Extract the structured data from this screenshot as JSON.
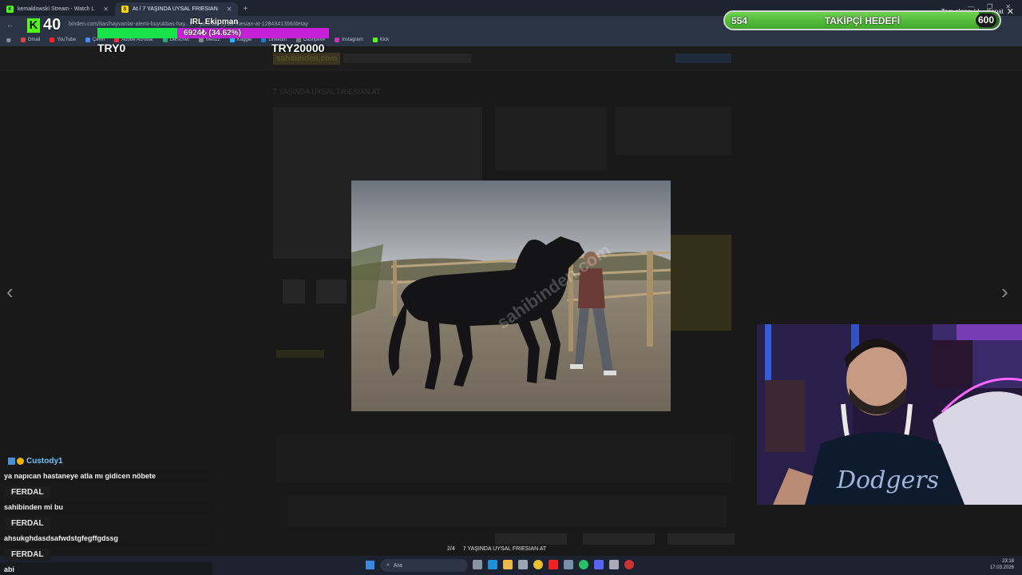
{
  "browser": {
    "tabs": [
      {
        "label": "kemaldowski Stream - Watch L",
        "favicon": "kick-icon",
        "color": "#53fc18",
        "active": false
      },
      {
        "label": "At / 7 YAŞINDA UYSAL FRIESIAN",
        "favicon": "sahibinden-icon",
        "color": "#ffd400",
        "active": true
      }
    ],
    "url": "binden.com/ilan/hayvanlar-alemi-buyukbas-hay...k-7-yasinda-uysal-friesian-at-1284341356/detay",
    "bookmarks": [
      "Gmail",
      "YouTube",
      "Çeviri",
      "Adobe Acrobat",
      "Dersonet",
      "Meuzz",
      "Kaggle",
      "LinkedIn",
      "Dashpeve",
      "Instagram",
      "Kick"
    ]
  },
  "page": {
    "logo": "sahibinden.com",
    "title": "7 YAŞINDA UYSAL FRIESIAN AT",
    "fullscreen_label": "Tam ekran",
    "close_label": "Kapat",
    "photo_caption": "7 YAŞINDA UYSAL FRIESIAN AT",
    "photo_counter": "2/4",
    "watermark": "sahibinden.com"
  },
  "overlay": {
    "kick_followers": "40",
    "try_left": "TRY0",
    "try_right": "TRY20000",
    "irl_title": "IRL Ekipman",
    "progress_text": "6924₺ (34.62%)",
    "progress_fraction": 0.3462,
    "follow_goal": {
      "title": "TAKİPÇİ HEDEFİ",
      "current": "554",
      "target": "600",
      "fraction": 0.923
    }
  },
  "chat": [
    {
      "user": "Custody1",
      "message": "ya napıcan hastaneye atla mı gidicen nöbete"
    },
    {
      "user": "FERDAL",
      "message": "sahibinden mi bu"
    },
    {
      "user": "FERDAL",
      "message": "ahsukghdasdsafwdstgfegffgdssg"
    },
    {
      "user": "FERDAL",
      "message": "abi"
    }
  ],
  "taskbar": {
    "search_placeholder": "Ara",
    "time": "23:18",
    "date": "17.03.2026"
  }
}
